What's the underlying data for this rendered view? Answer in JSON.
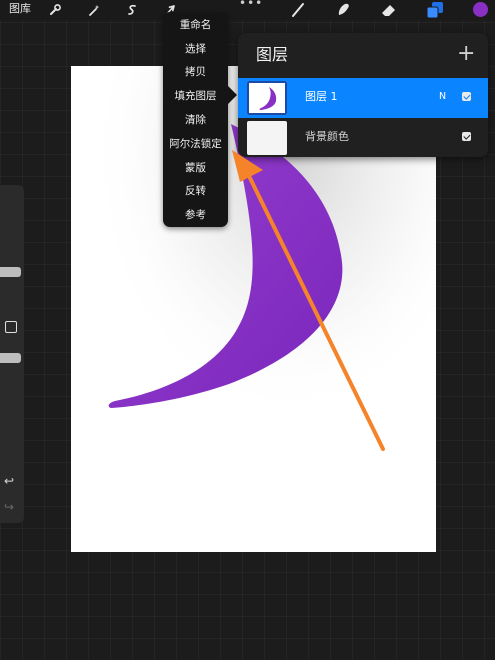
{
  "toolbar": {
    "gallery_label": "图库",
    "left_tools": [
      "wrench-icon",
      "magic-wand-icon",
      "selection-s-icon",
      "transform-arrow-icon"
    ],
    "more_label": "•••",
    "right_tools": [
      "brush-icon",
      "smudge-icon",
      "eraser-icon",
      "layers-icon"
    ],
    "current_color": "#8a2fc4"
  },
  "context_menu": {
    "items": [
      {
        "label": "重命名"
      },
      {
        "label": "选择"
      },
      {
        "label": "拷贝"
      },
      {
        "label": "填充图层"
      },
      {
        "label": "清除"
      },
      {
        "label": "阿尔法锁定"
      },
      {
        "label": "蒙版"
      },
      {
        "label": "反转"
      },
      {
        "label": "参考"
      }
    ]
  },
  "layers_panel": {
    "title": "图层",
    "add_label": "+",
    "layers": [
      {
        "name": "图层 1",
        "blend_mode": "N",
        "visible": true,
        "active": true
      },
      {
        "name": "背景颜色",
        "visible": true,
        "active": false
      }
    ]
  },
  "colors": {
    "stroke_purple": "#8a2fc4",
    "annotation_arrow": "#f5832a",
    "active_layer_blue": "#0a84ff"
  }
}
